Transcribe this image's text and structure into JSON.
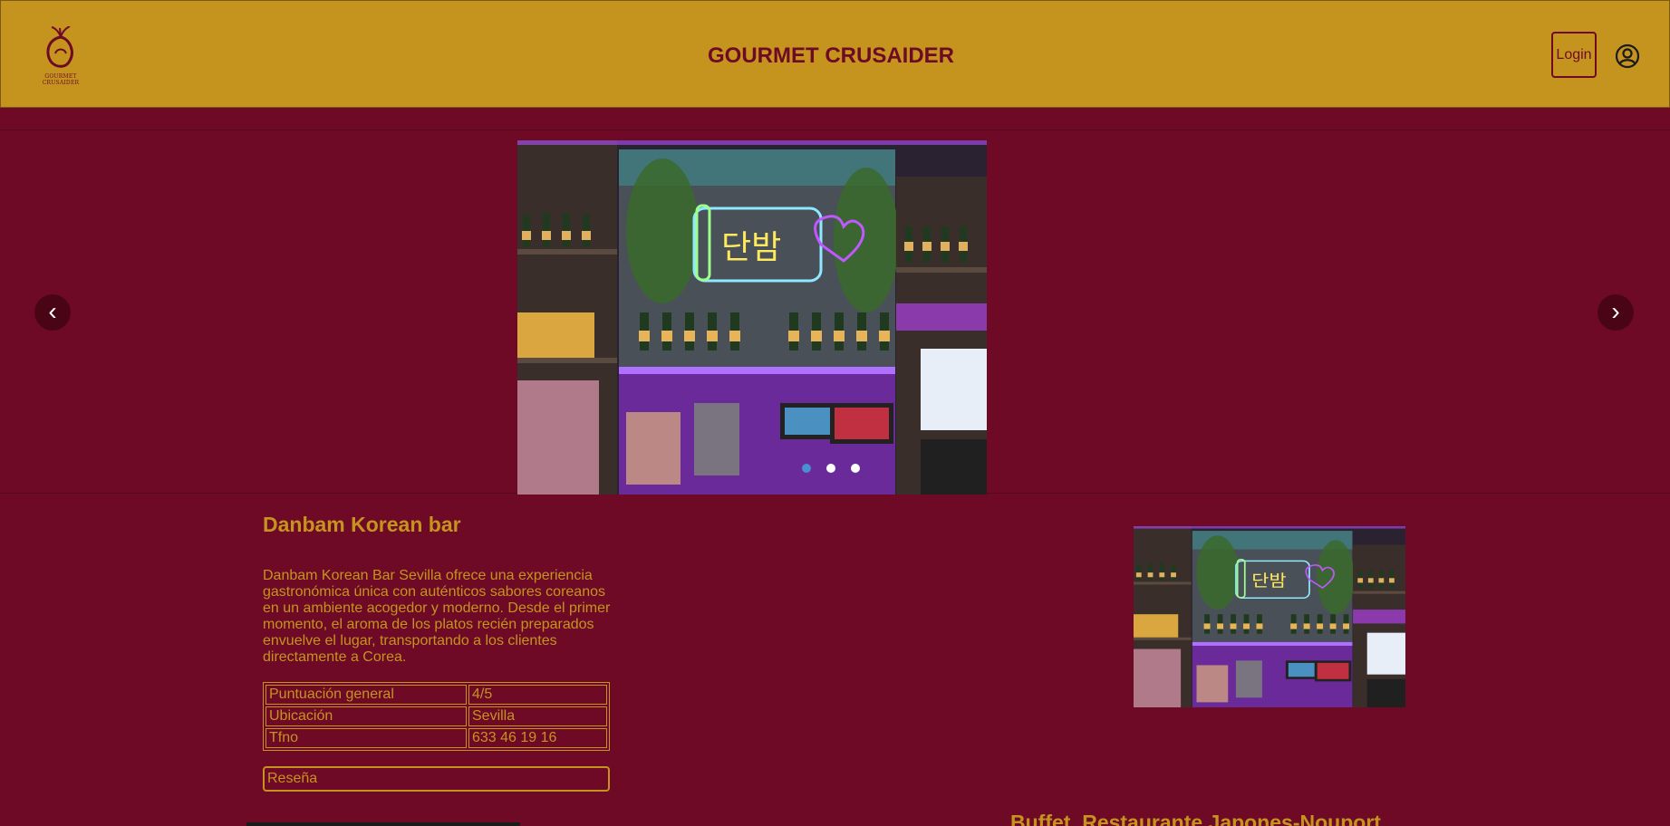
{
  "header": {
    "logo_text": "GOURMET CRUSAIDER",
    "title": "GOURMET CRUSAIDER",
    "login_label": "Login",
    "user_icon": "user-circle-icon"
  },
  "carousel": {
    "prev_label": "‹",
    "next_label": "›",
    "slide_count": 3,
    "active_slide": 1
  },
  "restaurant": {
    "name": "Danbam Korean bar",
    "description": "Danbam Korean Bar Sevilla ofrece una experiencia gastronómica única con auténticos sabores coreanos en un ambiente acogedor y moderno. Desde el primer momento, el aroma de los platos recién preparados envuelve el lugar, transportando a los clientes directamente a Corea.",
    "table": [
      {
        "label": "Puntuación general",
        "value": "4/5"
      },
      {
        "label": "Ubicación",
        "value": "Sevilla"
      },
      {
        "label": "Tfno",
        "value": "633 46 19 16"
      }
    ],
    "review_label": "Reseña"
  },
  "next_restaurant": {
    "name": "Buffet, Restaurante Japones-Nouport"
  },
  "colors": {
    "background": "#6e0a26",
    "header": "#c5941f",
    "accent": "#c5941f"
  }
}
